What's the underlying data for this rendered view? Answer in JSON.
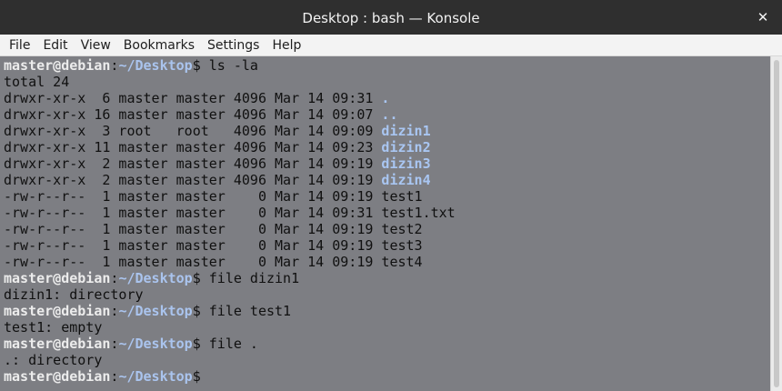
{
  "window": {
    "title": "Desktop : bash — Konsole",
    "close_glyph": "✕"
  },
  "menu": [
    "File",
    "Edit",
    "View",
    "Bookmarks",
    "Settings",
    "Help"
  ],
  "colors": {
    "terminal_bg": "#7d7e83",
    "prompt_user": "#ececec",
    "prompt_path": "#aac4ee",
    "directory": "#a9c6f2",
    "text": "#101010"
  },
  "prompt": {
    "user_host": "master@debian",
    "sep": ":",
    "path": "~/Desktop",
    "dollar": "$"
  },
  "lines": [
    {
      "type": "prompt",
      "cmd": " ls -la"
    },
    {
      "type": "out",
      "text": "total 24"
    },
    {
      "type": "ls",
      "meta": "drwxr-xr-x  6 master master 4096 Mar 14 09:31 ",
      "name": ".",
      "dir": true
    },
    {
      "type": "ls",
      "meta": "drwxr-xr-x 16 master master 4096 Mar 14 09:07 ",
      "name": "..",
      "dir": true
    },
    {
      "type": "ls",
      "meta": "drwxr-xr-x  3 root   root   4096 Mar 14 09:09 ",
      "name": "dizin1",
      "dir": true
    },
    {
      "type": "ls",
      "meta": "drwxr-xr-x 11 master master 4096 Mar 14 09:23 ",
      "name": "dizin2",
      "dir": true
    },
    {
      "type": "ls",
      "meta": "drwxr-xr-x  2 master master 4096 Mar 14 09:19 ",
      "name": "dizin3",
      "dir": true
    },
    {
      "type": "ls",
      "meta": "drwxr-xr-x  2 master master 4096 Mar 14 09:19 ",
      "name": "dizin4",
      "dir": true
    },
    {
      "type": "ls",
      "meta": "-rw-r--r--  1 master master    0 Mar 14 09:19 ",
      "name": "test1",
      "dir": false
    },
    {
      "type": "ls",
      "meta": "-rw-r--r--  1 master master    0 Mar 14 09:31 ",
      "name": "test1.txt",
      "dir": false
    },
    {
      "type": "ls",
      "meta": "-rw-r--r--  1 master master    0 Mar 14 09:19 ",
      "name": "test2",
      "dir": false
    },
    {
      "type": "ls",
      "meta": "-rw-r--r--  1 master master    0 Mar 14 09:19 ",
      "name": "test3",
      "dir": false
    },
    {
      "type": "ls",
      "meta": "-rw-r--r--  1 master master    0 Mar 14 09:19 ",
      "name": "test4",
      "dir": false
    },
    {
      "type": "prompt",
      "cmd": " file dizin1"
    },
    {
      "type": "out",
      "text": "dizin1: directory"
    },
    {
      "type": "prompt",
      "cmd": " file test1"
    },
    {
      "type": "out",
      "text": "test1: empty"
    },
    {
      "type": "prompt",
      "cmd": " file ."
    },
    {
      "type": "out",
      "text": ".: directory"
    },
    {
      "type": "prompt",
      "cmd": ""
    }
  ]
}
